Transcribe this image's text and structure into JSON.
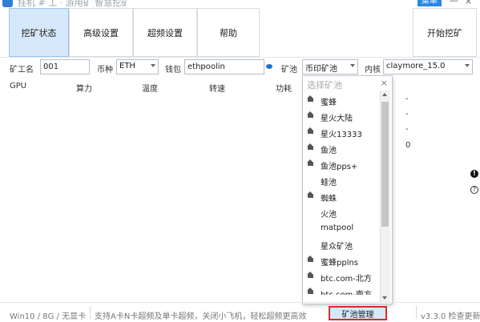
{
  "window": {
    "title": "挂机 # 工 · 游用矿 智慧挖矿",
    "menu_label": "菜单",
    "minimize": "—",
    "close": "×"
  },
  "tabs": [
    {
      "label": "挖矿状态"
    },
    {
      "label": "高级设置"
    },
    {
      "label": "超频设置"
    },
    {
      "label": "帮助"
    }
  ],
  "start_button": "开始挖矿",
  "form": {
    "worker_label": "矿工名",
    "worker_value": "001",
    "coin_label": "币种",
    "coin_value": "ETH",
    "wallet_label": "钱包",
    "wallet_value": "ethpoolin",
    "pool_label": "矿池",
    "pool_value": "币印矿池",
    "kernel_label": "内核",
    "kernel_value": "claymore_15.0"
  },
  "table": {
    "headers": [
      "GPU",
      "算力",
      "温度",
      "转速",
      "功耗"
    ]
  },
  "dropdown": {
    "title": "选择矿池",
    "close": "×",
    "items": [
      {
        "label": "蜜蜂",
        "icon": true
      },
      {
        "label": "星火大陆",
        "icon": true
      },
      {
        "label": "星火13333",
        "icon": true
      },
      {
        "label": "鱼池",
        "icon": true
      },
      {
        "label": "鱼池pps+",
        "icon": true
      },
      {
        "label": "蛙池",
        "icon": false
      },
      {
        "label": "蜘蛛",
        "icon": true
      },
      {
        "label": "火池",
        "icon": false
      },
      {
        "label": "matpool",
        "icon": false
      },
      {
        "label": "星众矿池",
        "icon": false
      },
      {
        "label": "蜜蜂pplns",
        "icon": true
      },
      {
        "label": "btc.com-北方",
        "icon": true
      },
      {
        "label": "btc.com-南方",
        "icon": true
      }
    ],
    "manage_label": "矿池管理"
  },
  "right_values": [
    "-",
    "-",
    "-",
    "0"
  ],
  "side_markers": {
    "info": "!",
    "help": "?"
  },
  "statusbar": {
    "system": "Win10 / 8G / 无显卡",
    "message": "支持A卡N卡超频及单卡超频，关闭小飞机，轻松超频更高效",
    "version": "v3.3.0 检查更新"
  },
  "colors": {
    "accent": "#2c86e0",
    "tab_active": "#d6e8fb",
    "highlight_border": "#e0282a"
  }
}
